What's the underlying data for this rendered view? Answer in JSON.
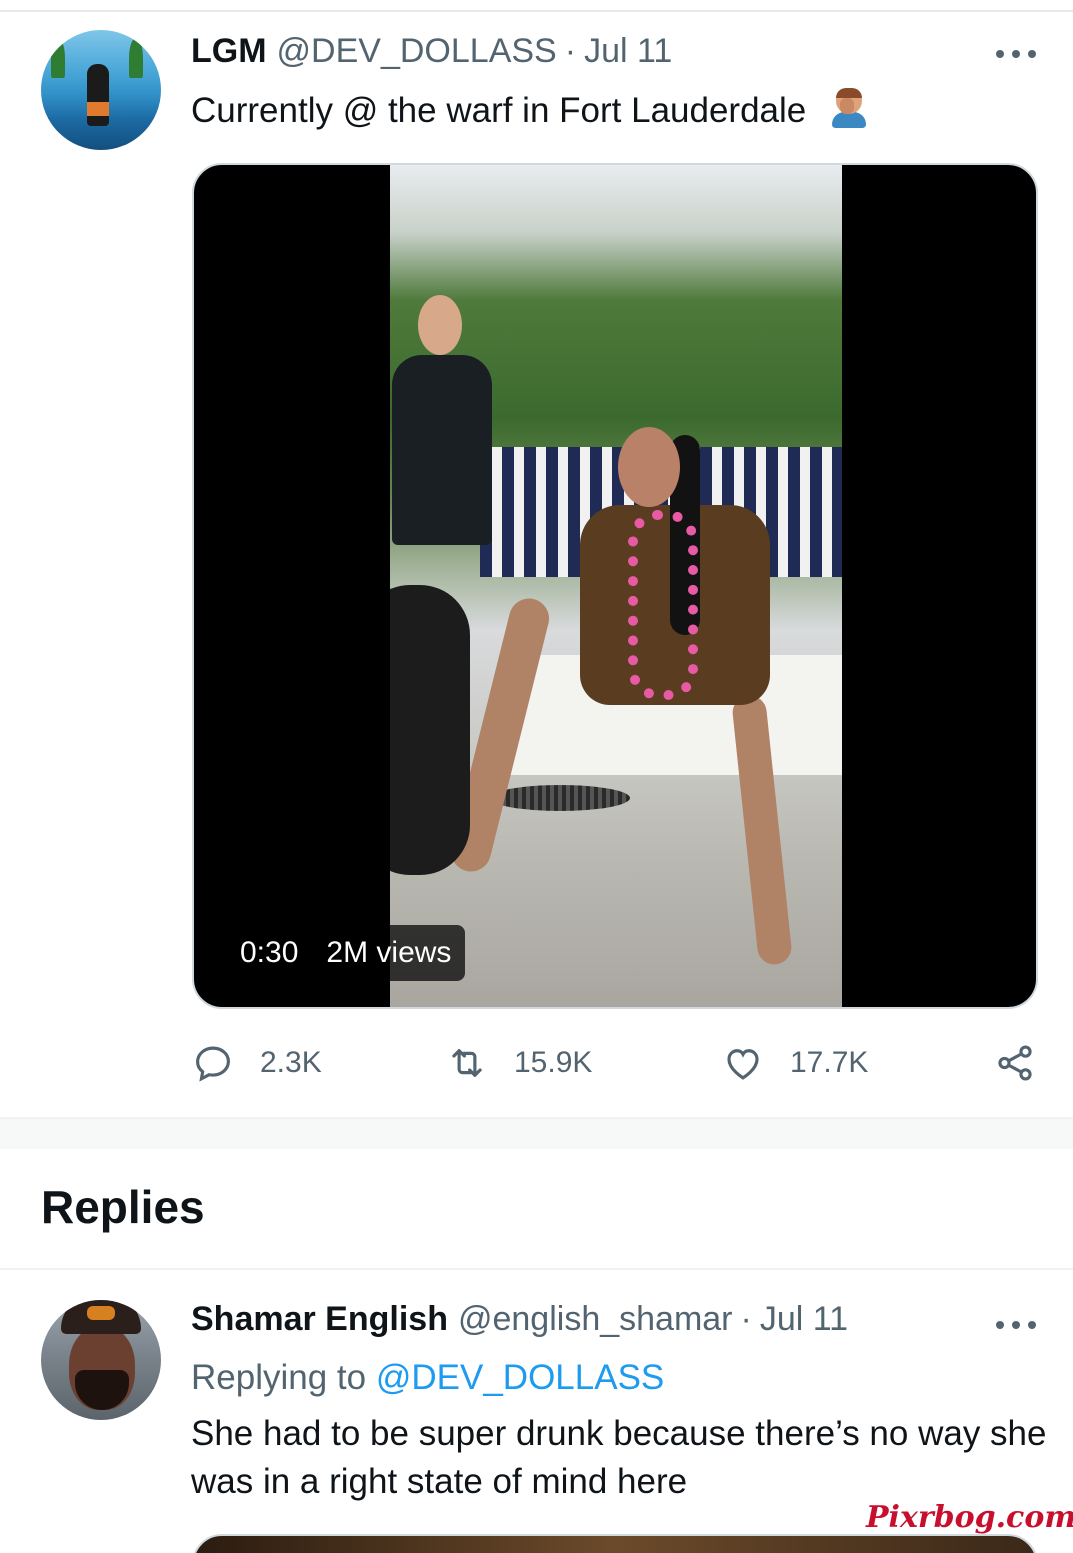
{
  "tweet": {
    "author_name": "LGM",
    "author_handle": "@DEV_DOLLASS",
    "separator": "·",
    "date": "Jul 11",
    "text": "Currently @ the warf in Fort Lauderdale",
    "emoji_icon": "facepalm-emoji",
    "video": {
      "duration": "0:30",
      "views": "2M views"
    },
    "actions": {
      "replies": {
        "icon": "reply-icon",
        "count": "2.3K"
      },
      "retweets": {
        "icon": "retweet-icon",
        "count": "15.9K"
      },
      "likes": {
        "icon": "heart-icon",
        "count": "17.7K"
      },
      "share": {
        "icon": "share-icon"
      }
    }
  },
  "replies_section": {
    "title": "Replies"
  },
  "reply": {
    "author_name": "Shamar English",
    "author_handle": "@english_shamar",
    "separator": "·",
    "date": "Jul 11",
    "replying_prefix": "Replying to",
    "replying_handle": "@DEV_DOLLASS",
    "text": "She had to be super drunk because there’s no way she was in a right state of mind here"
  },
  "watermark": "Pixrbog.com",
  "colors": {
    "text_primary": "#0f1419",
    "text_secondary": "#536471",
    "accent_blue": "#1d9bf0",
    "border": "#cfd9de"
  }
}
